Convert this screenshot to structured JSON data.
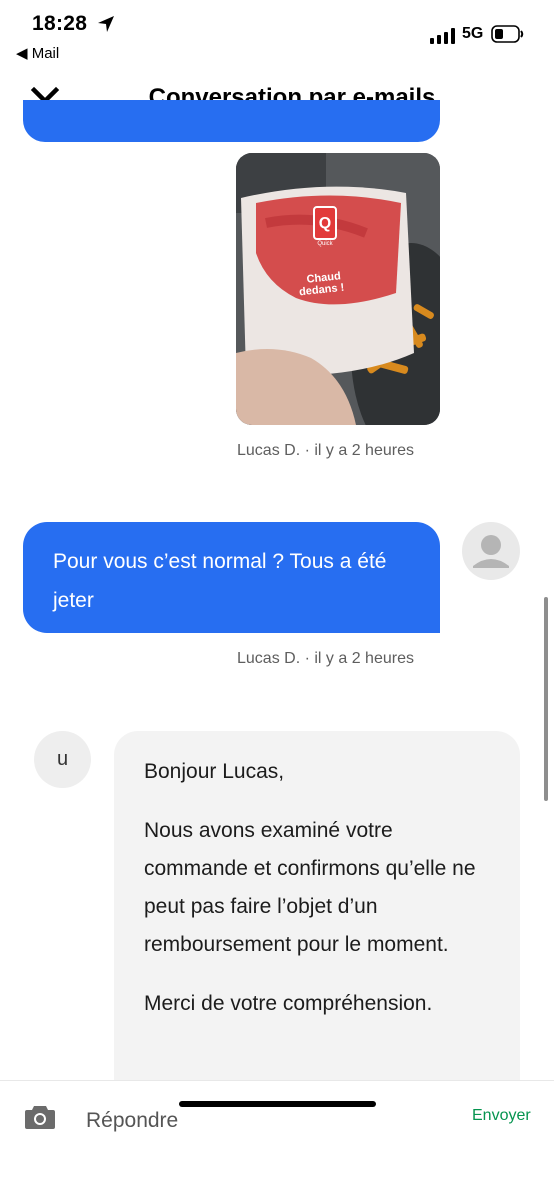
{
  "status_bar": {
    "time": "18:28",
    "back_app": "Mail",
    "network": "5G"
  },
  "header": {
    "title": "Conversation par e-mails",
    "close_icon": "close-icon"
  },
  "messages": [
    {
      "type": "image",
      "image_text": [
        "Chaud",
        "dedans !"
      ],
      "brand_letter": "Q",
      "brand_small": "Quick",
      "meta": "Lucas D. · il y a 2 heures"
    },
    {
      "type": "text",
      "text": "Pour vous c’est normal ? Tous a été jeter",
      "meta": "Lucas D. · il y a 2 heures"
    },
    {
      "type": "support",
      "avatar_letter": "u",
      "paragraphs": [
        "Bonjour Lucas,",
        "Nous avons examiné votre commande et confirmons qu’elle ne peut pas faire l’objet d’un remboursement pour le moment.",
        "Merci de votre compréhension."
      ]
    }
  ],
  "composer": {
    "placeholder": "Répondre",
    "send_label": "Envoyer"
  },
  "colors": {
    "user_bubble": "#276ef1",
    "support_bubble": "#f3f3f3",
    "send": "#05944f"
  }
}
